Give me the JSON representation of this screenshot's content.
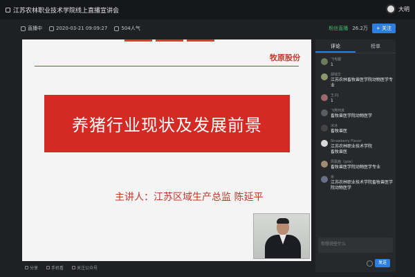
{
  "window": {
    "title": "江苏农林职业技术学院线上直播宣讲会",
    "user_name": "大明"
  },
  "info": {
    "status": "直播中",
    "datetime": "2020-03-21 09:09:27",
    "popularity": "504人气",
    "follow_status": "粉丝直播",
    "follower_count": "26.2万",
    "follow_button": "+ 关注"
  },
  "slide": {
    "brand": "牧原股份",
    "headline": "养猪行业现状及发展前景",
    "presenter": "主讲人：江苏区域生产总监  陈延平"
  },
  "bottom": {
    "share": "分享",
    "mobile": "手机看",
    "follow_official": "关注公众号"
  },
  "panel": {
    "tabs": [
      "评论",
      "榜单"
    ],
    "comments": [
      {
        "name": "飞毛腿",
        "text": "1"
      },
      {
        "name": "胡钱华",
        "text": "江苏农林畜牧兽医学院动物医学专业"
      },
      {
        "name": "王子J",
        "text": "1"
      },
      {
        "name": "飞燕何其",
        "text": "畜牧兽医学院动物医学"
      },
      {
        "name": "冰冰",
        "text": "畜牧兽医"
      },
      {
        "name": "Strawberry Flavor",
        "text": "江苏农林职业技术学院\n畜牧兽医"
      },
      {
        "name": "周嘉茜（gzw）",
        "text": "畜牧兽医学院动物医学专业"
      },
      {
        "name": "余",
        "text": "江苏农林职业技术学院畜牧兽医学院动物医学"
      }
    ],
    "compose_placeholder": "你想说些什么",
    "send_label": "发送"
  },
  "colors": {
    "accent": "#2a7fe0",
    "slide_red": "#d42a24",
    "bg": "#1f2024"
  }
}
